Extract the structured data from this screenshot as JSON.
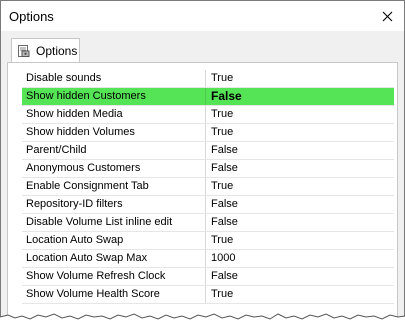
{
  "window": {
    "title": "Options"
  },
  "tabs": [
    {
      "label": "Options",
      "icon": "options-page-icon"
    }
  ],
  "selection_color": "#55e455",
  "properties": [
    {
      "name": "Disable sounds",
      "value": "True",
      "selected": false
    },
    {
      "name": "Show hidden Customers",
      "value": "False",
      "selected": true
    },
    {
      "name": "Show hidden Media",
      "value": "True",
      "selected": false
    },
    {
      "name": "Show hidden Volumes",
      "value": "True",
      "selected": false
    },
    {
      "name": "Parent/Child",
      "value": "False",
      "selected": false
    },
    {
      "name": "Anonymous Customers",
      "value": "False",
      "selected": false
    },
    {
      "name": "Enable Consignment Tab",
      "value": "True",
      "selected": false
    },
    {
      "name": "Repository-ID filters",
      "value": "False",
      "selected": false
    },
    {
      "name": "Disable Volume List inline edit",
      "value": "False",
      "selected": false
    },
    {
      "name": "Location Auto Swap",
      "value": "True",
      "selected": false
    },
    {
      "name": "Location Auto Swap Max",
      "value": "1000",
      "selected": false
    },
    {
      "name": "Show Volume Refresh Clock",
      "value": "False",
      "selected": false
    },
    {
      "name": "Show Volume Health Score",
      "value": "True",
      "selected": false
    }
  ]
}
